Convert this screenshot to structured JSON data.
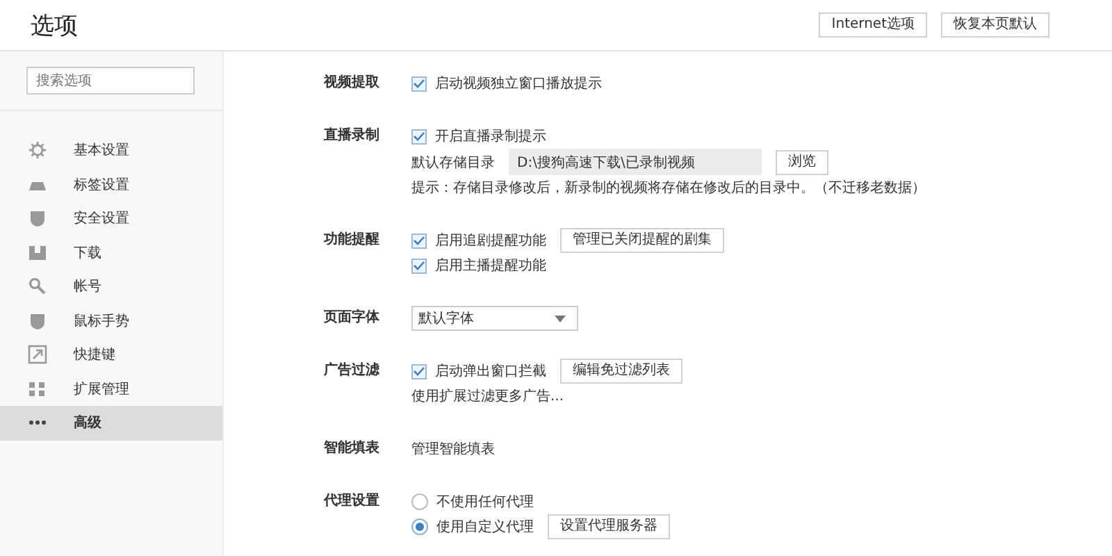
{
  "window": {
    "title": "选项"
  },
  "header_buttons": [
    "Internet选项",
    "恢复本页默认"
  ],
  "sidebar": {
    "search": {
      "placeholder": "搜索选项"
    },
    "items": [
      {
        "label": "基本设置",
        "selected": false
      },
      {
        "label": "标签设置",
        "selected": false
      },
      {
        "label": "安全设置",
        "selected": false
      },
      {
        "label": "下载",
        "selected": false
      },
      {
        "label": "帐号",
        "selected": false
      },
      {
        "label": "鼠标手势",
        "selected": false
      },
      {
        "label": "快捷键",
        "selected": false
      },
      {
        "label": "扩展管理",
        "selected": false
      },
      {
        "label": "高级",
        "selected": true
      }
    ]
  },
  "sections": [
    {
      "label": "视频提取",
      "lines": [
        {
          "kind": "checkbox",
          "text": "启动视频独立窗口播放提示",
          "checked": true
        }
      ]
    },
    {
      "label": "直播录制",
      "lines": [
        {
          "kind": "checkbox",
          "text": "开启直播录制提示",
          "checked": true
        },
        {
          "kind": "path",
          "text": "默认存储目录",
          "value": "D:\\搜狗高速下载\\已录制视频",
          "button": "浏览"
        },
        {
          "kind": "note",
          "text": "提示：存储目录修改后，新录制的视频将存储在修改后的目录中。（不迁移老数据）"
        }
      ]
    },
    {
      "label": "功能提醒",
      "lines": [
        {
          "kind": "checkbox",
          "text": "启用追剧提醒功能",
          "checked": true,
          "button": "管理已关闭提醒的剧集"
        },
        {
          "kind": "checkbox",
          "text": "启用主播提醒功能",
          "checked": true
        }
      ]
    },
    {
      "label": "页面字体",
      "lines": [
        {
          "kind": "select",
          "value": "默认字体"
        }
      ]
    },
    {
      "label": "广告过滤",
      "lines": [
        {
          "kind": "checkbox",
          "text": "启动弹出窗口拦截",
          "checked": true,
          "button": "编辑免过滤列表"
        },
        {
          "kind": "link",
          "text": "使用扩展过滤更多广告..."
        }
      ]
    },
    {
      "label": "智能填表",
      "lines": [
        {
          "kind": "link",
          "text": "管理智能填表"
        }
      ]
    },
    {
      "label": "代理设置",
      "lines": [
        {
          "kind": "radio",
          "text": "不使用任何代理",
          "selected": false
        },
        {
          "kind": "radio",
          "text": "使用自定义代理",
          "selected": true,
          "button": "设置代理服务器"
        }
      ]
    }
  ]
}
